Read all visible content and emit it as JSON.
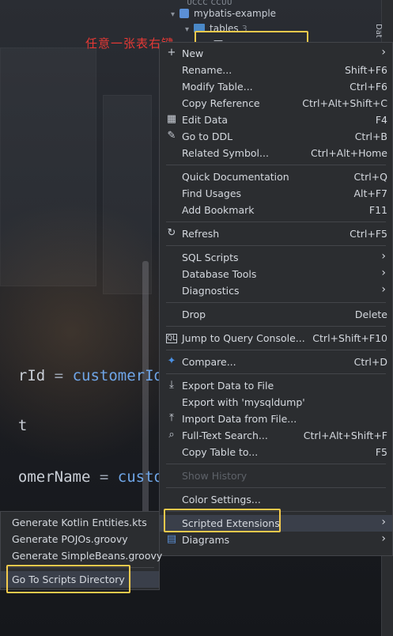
{
  "tree": {
    "top_partial": "ᴜᴄᴄᴄ ᴄᴄᴜᴜ",
    "db_name": "mybatis-example",
    "tables_label": "tables",
    "tables_count": "3",
    "selected_item": "—",
    "side_tab_label": "Dat"
  },
  "annotation": "任意一张表右键",
  "editor": {
    "line1_ident": "rId",
    "line1_op": "=",
    "line1_var": "customerId",
    "line2": "t",
    "line3_ident": "omerName",
    "line3_op": "=",
    "line3_var": "custor"
  },
  "menu": {
    "new": {
      "label": "New"
    },
    "rename": {
      "label": "Rename...",
      "shortcut": "Shift+F6"
    },
    "modify_table": {
      "label": "Modify Table...",
      "shortcut": "Ctrl+F6"
    },
    "copy_reference": {
      "label": "Copy Reference",
      "shortcut": "Ctrl+Alt+Shift+C"
    },
    "edit_data": {
      "label": "Edit Data",
      "shortcut": "F4"
    },
    "go_to_ddl": {
      "label": "Go to DDL",
      "shortcut": "Ctrl+B"
    },
    "related_symbol": {
      "label": "Related Symbol...",
      "shortcut": "Ctrl+Alt+Home"
    },
    "quick_doc": {
      "label": "Quick Documentation",
      "shortcut": "Ctrl+Q"
    },
    "find_usages": {
      "label": "Find Usages",
      "shortcut": "Alt+F7"
    },
    "add_bookmark": {
      "label": "Add Bookmark",
      "shortcut": "F11"
    },
    "refresh": {
      "label": "Refresh",
      "shortcut": "Ctrl+F5"
    },
    "sql_scripts": {
      "label": "SQL Scripts"
    },
    "database_tools": {
      "label": "Database Tools"
    },
    "diagnostics": {
      "label": "Diagnostics"
    },
    "drop": {
      "label": "Drop",
      "shortcut": "Delete"
    },
    "jump_console": {
      "label": "Jump to Query Console...",
      "shortcut": "Ctrl+Shift+F10"
    },
    "compare": {
      "label": "Compare...",
      "shortcut": "Ctrl+D"
    },
    "export_data": {
      "label": "Export Data to File"
    },
    "export_mysqldump": {
      "label": "Export with 'mysqldump'"
    },
    "import_data": {
      "label": "Import Data from File..."
    },
    "full_text_search": {
      "label": "Full-Text Search...",
      "shortcut": "Ctrl+Alt+Shift+F"
    },
    "copy_table": {
      "label": "Copy Table to...",
      "shortcut": "F5"
    },
    "show_history": {
      "label": "Show History"
    },
    "color_settings": {
      "label": "Color Settings..."
    },
    "scripted_extensions": {
      "label": "Scripted Extensions"
    },
    "diagrams": {
      "label": "Diagrams"
    }
  },
  "submenu": {
    "items": [
      "Generate Kotlin Entities.kts",
      "Generate POJOs.groovy",
      "Generate SimpleBeans.groovy"
    ],
    "go_to_dir": "Go To Scripts Directory"
  },
  "colors": {
    "highlight": "#f2c94c",
    "annotation": "#e53935",
    "menu_bg": "#2b2d30",
    "code_var": "#6fa6e8"
  }
}
